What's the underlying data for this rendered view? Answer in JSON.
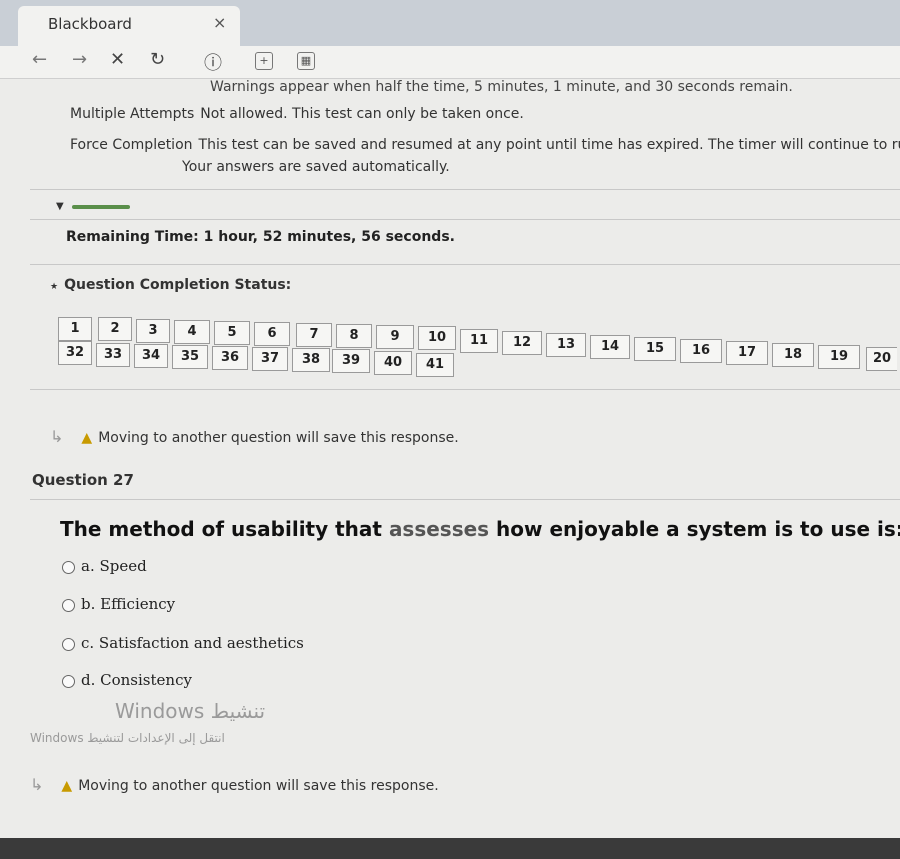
{
  "browser": {
    "tab_title": "Blackboard",
    "tab_close": "×",
    "toolbar": {
      "back": "←",
      "forward": "→",
      "stop": "✕",
      "reload": "↻",
      "info": "ⓘ",
      "plus": "+",
      "calendar": "▦"
    }
  },
  "test_info": {
    "warnings": "Warnings appear when half the time, 5 minutes, 1 minute, and 30 seconds remain.",
    "multiple_attempts_label": "Multiple Attempts",
    "multiple_attempts_text": "Not allowed. This test can only be taken once.",
    "force_completion_label": "Force Completion",
    "force_completion_text": "This test can be saved and resumed at any point until time has expired. The timer will continue to run",
    "auto_save": "Your answers are saved automatically."
  },
  "timer": {
    "collapse_icon": "▼",
    "remaining": "Remaining Time: 1 hour, 52 minutes, 56 seconds."
  },
  "completion": {
    "title": "Question Completion Status:",
    "icon": "★",
    "row1": [
      "1",
      "2",
      "3",
      "4",
      "5",
      "6",
      "7",
      "8",
      "9",
      "10",
      "11",
      "12",
      "13",
      "14",
      "15",
      "16",
      "17",
      "18",
      "19",
      "20"
    ],
    "row2": [
      "32",
      "33",
      "34",
      "35",
      "36",
      "37",
      "38",
      "39",
      "40",
      "41"
    ]
  },
  "notice": {
    "arrow": "↳",
    "warn_icon": "▲",
    "text": "Moving to another question will save this response."
  },
  "question": {
    "number": "Question 27",
    "text_a": "The method of usability that ",
    "text_b": "assesses",
    "text_c": " how enjoyable a system is to use is:",
    "options": [
      "a. Speed",
      "b. Efficiency",
      "c. Satisfaction and aesthetics",
      "d. Consistency"
    ]
  },
  "watermark": {
    "line1": "Windows تنشيط",
    "line2": "Windows انتقل إلى الإعدادات لتنشيط"
  }
}
